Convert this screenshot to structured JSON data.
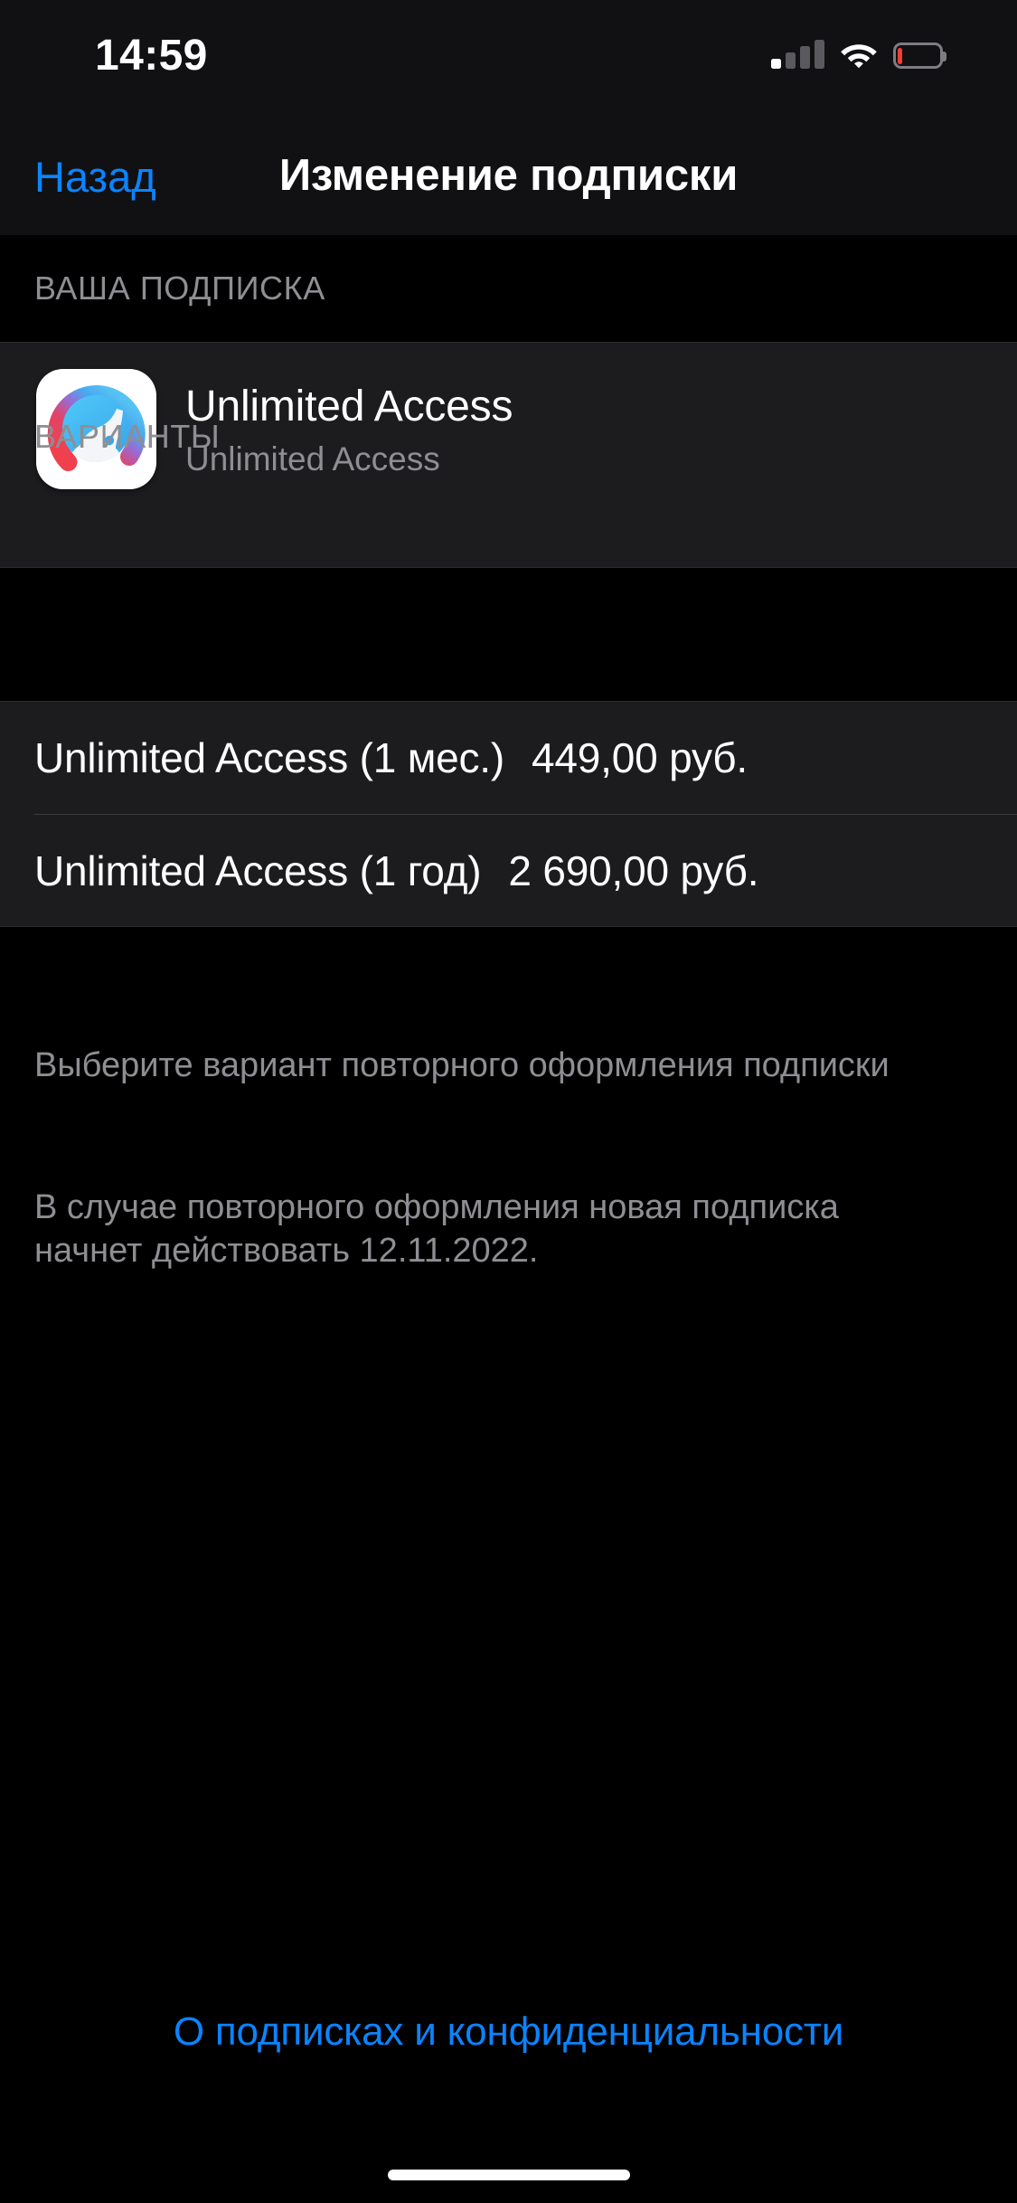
{
  "status_bar": {
    "time": "14:59",
    "cellular_icon": "cellular-signal-icon",
    "cellular_bars_active": 1,
    "cellular_bars_total": 4,
    "wifi_icon": "wifi-icon",
    "battery_icon": "battery-icon",
    "battery_level_percent": 12,
    "battery_color": "#ff3b30"
  },
  "nav": {
    "back_label": "Назад",
    "title": "Изменение подписки",
    "accent_color": "#0a84ff"
  },
  "subscription_section": {
    "header": "ВАША ПОДПИСКА",
    "app_icon_name": "facetune-app-icon",
    "title": "Unlimited Access",
    "subtitle": "Unlimited Access"
  },
  "options_section": {
    "header": "ВАРИАНТЫ",
    "options": [
      {
        "name": "Unlimited Access (1 мес.)",
        "price": "449,00 руб."
      },
      {
        "name": "Unlimited Access (1 год)",
        "price": "2 690,00 руб."
      }
    ]
  },
  "footer_notes": [
    "Выберите вариант повторного оформления подписки",
    "В случае повторного оформления новая подписка начнет действовать 12.11.2022."
  ],
  "bottom_link": {
    "label": "О подписках и конфиденциальности",
    "color": "#0a84ff"
  },
  "home_indicator": "home-indicator",
  "theme": {
    "background": "#000000",
    "card_background": "#1c1c1e",
    "nav_background": "#111113",
    "separator": "#3a3a3c",
    "secondary_text": "#8e8e93",
    "primary_text": "#ffffff"
  }
}
